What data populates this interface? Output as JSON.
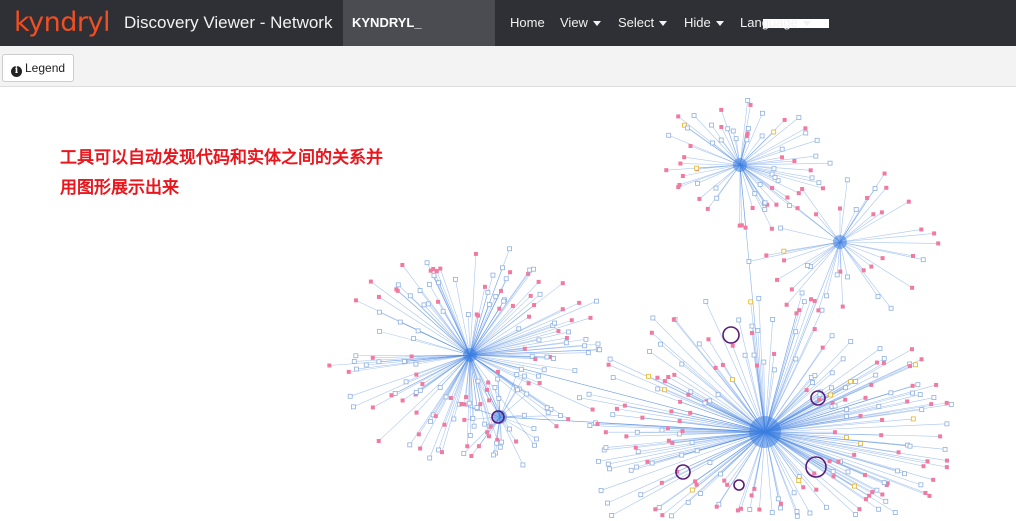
{
  "brand": {
    "name": "kyndryl",
    "color": "#f04e23"
  },
  "app_title": "Discovery Viewer - Network",
  "active_tab": "KYNDRYL_",
  "nav": {
    "home": "Home",
    "view": "View",
    "select": "Select",
    "hide": "Hide",
    "language": "Language"
  },
  "toolbar": {
    "legend_label": "Legend",
    "legend_icon": "info-icon"
  },
  "annotation": {
    "line1": "工具可以自动发现代码和实体之间的关系并",
    "line2": "用图形展示出来"
  },
  "colors": {
    "navbar": "#2e3035",
    "edge": "#3d7fe0",
    "node_blue": "#8fb0e0",
    "node_pink": "#f07aa0",
    "node_yellow": "#e6b422",
    "highlight_ring": "#5a1a7a",
    "annotation": "#e8161d"
  }
}
